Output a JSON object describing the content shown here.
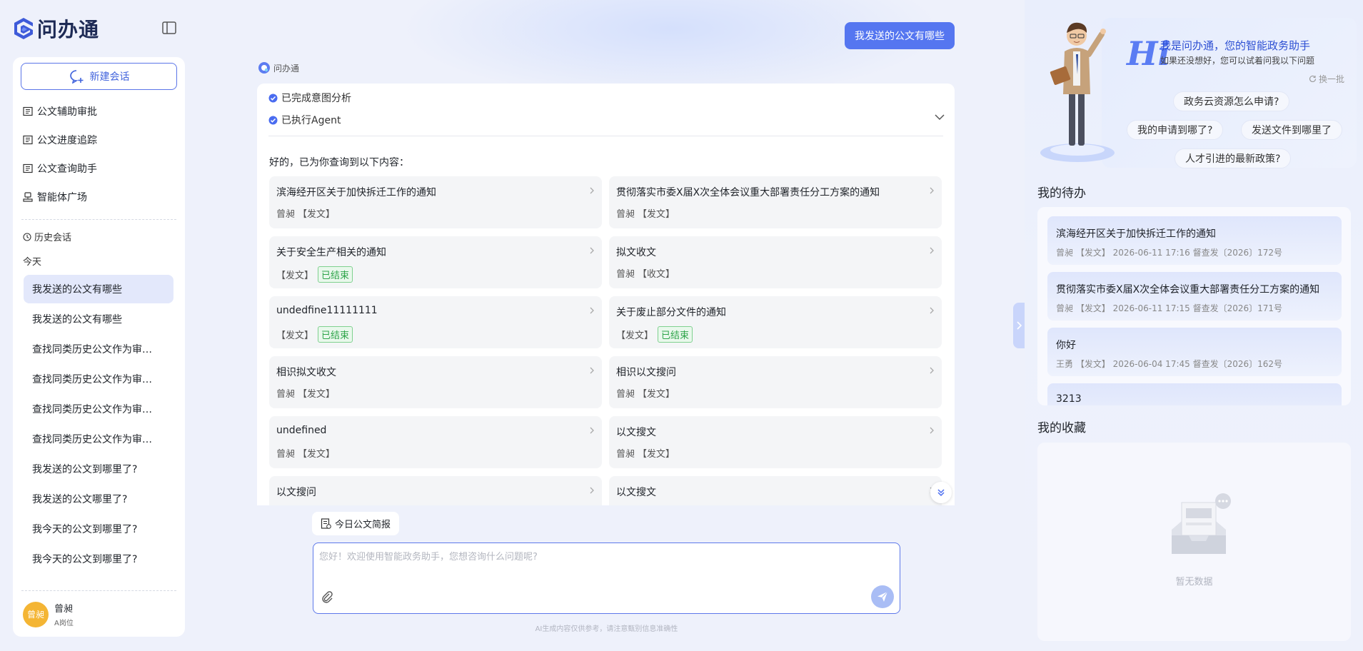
{
  "app": {
    "name": "问办通"
  },
  "sidebar": {
    "new_chat": "新建会话",
    "menu": [
      {
        "label": "公文辅助审批",
        "icon": "doc-icon"
      },
      {
        "label": "公文进度追踪",
        "icon": "doc-icon"
      },
      {
        "label": "公文查询助手",
        "icon": "doc-icon"
      },
      {
        "label": "智能体广场",
        "icon": "agent-icon"
      }
    ],
    "history_title": "历史会话",
    "today_label": "今天",
    "history": [
      "我发送的公文有哪些",
      "我发送的公文有哪些",
      "查找同类历史公文作为审…",
      "查找同类历史公文作为审…",
      "查找同类历史公文作为审…",
      "查找同类历史公文作为审…",
      "我发送的公文到哪里了?",
      "我发送的公文哪里了?",
      "我今天的公文到哪里了?",
      "我今天的公文到哪里了?"
    ],
    "user": {
      "avatar_text": "曾昶",
      "name": "曾昶",
      "role": "A岗位"
    }
  },
  "chat": {
    "question": "我发送的公文有哪些",
    "bot_name": "问办通",
    "steps": [
      "已完成意图分析",
      "已执行Agent"
    ],
    "lead": "好的，已为你查询到以下内容：",
    "results": [
      {
        "title": "滨海经开区关于加快拆迁工作的通知",
        "author": "曾昶",
        "type": "【发文】",
        "status": ""
      },
      {
        "title": "贯彻落实市委X届X次全体会议重大部署责任分工方案的通知",
        "author": "曾昶",
        "type": "【发文】",
        "status": ""
      },
      {
        "title": "关于安全生产相关的通知",
        "author": "",
        "type": "【发文】",
        "status": "已结束"
      },
      {
        "title": "拟文收文",
        "author": "曾昶",
        "type": "【收文】",
        "status": ""
      },
      {
        "title": "undedfine11111111",
        "author": "",
        "type": "【发文】",
        "status": "已结束"
      },
      {
        "title": "关于废止部分文件的通知",
        "author": "",
        "type": "【发文】",
        "status": "已结束"
      },
      {
        "title": "相识拟文收文",
        "author": "曾昶",
        "type": "【发文】",
        "status": ""
      },
      {
        "title": "相识以文搜问",
        "author": "曾昶",
        "type": "【发文】",
        "status": ""
      },
      {
        "title": "undefined",
        "author": "曾昶",
        "type": "【发文】",
        "status": ""
      },
      {
        "title": "以文搜文",
        "author": "曾昶",
        "type": "【发文】",
        "status": ""
      },
      {
        "title": "以文搜问",
        "author": "",
        "type": "",
        "status": ""
      },
      {
        "title": "以文搜文",
        "author": "",
        "type": "",
        "status": ""
      }
    ],
    "brief_button": "今日公文简报",
    "input_placeholder": "您好！欢迎使用智能政务助手，您想咨询什么问题呢?",
    "disclaimer": "AI生成内容仅供参考，请注意甄别信息准确性"
  },
  "right": {
    "hi": "Hi",
    "greeting": "我是问办通，您的智能政务助手",
    "sub": "如果还没想好，您可以试着问我以下问题",
    "refresh": "换一批",
    "suggestions": [
      "政务云资源怎么申请?",
      "我的申请到哪了?",
      "发送文件到哪里了",
      "人才引进的最新政策?"
    ],
    "todo_title": "我的待办",
    "todos": [
      {
        "title": "滨海经开区关于加快拆迁工作的通知",
        "meta": "曾昶 【发文】 2026-06-11 17:16 督查发〔2026〕172号"
      },
      {
        "title": "贯彻落实市委X届X次全体会议重大部署责任分工方案的通知",
        "meta": "曾昶 【发文】 2026-06-11 17:15 督查发〔2026〕171号"
      },
      {
        "title": "你好",
        "meta": "王勇 【发文】 2026-06-04 17:45 督查发〔2026〕162号"
      },
      {
        "title": "3213",
        "meta": ""
      }
    ],
    "fav_title": "我的收藏",
    "empty": "暂无数据"
  },
  "colors": {
    "primary": "#5576f0",
    "success": "#2fa44a",
    "avatar": "#f4b534"
  }
}
